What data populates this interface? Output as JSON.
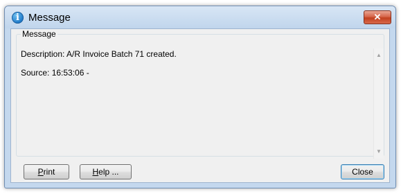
{
  "window": {
    "title": "Message",
    "close_glyph": "✕"
  },
  "group": {
    "legend": "Message"
  },
  "message": {
    "description": "Description: A/R Invoice Batch 71 created.",
    "source": "Source:  16:53:06 -"
  },
  "buttons": {
    "print": {
      "mnemonic": "P",
      "rest": "rint"
    },
    "help": {
      "mnemonic": "H",
      "rest": "elp ..."
    },
    "close": "Close"
  },
  "icons": {
    "title_icon": "info-icon",
    "scroll_up": "scroll-up-arrow-icon",
    "scroll_down": "scroll-down-arrow-icon"
  },
  "colors": {
    "title_bar": "#c4d8ee",
    "close_button": "#c1401f",
    "info_icon": "#1d78c8",
    "dialog_body": "#f0f0f0"
  }
}
